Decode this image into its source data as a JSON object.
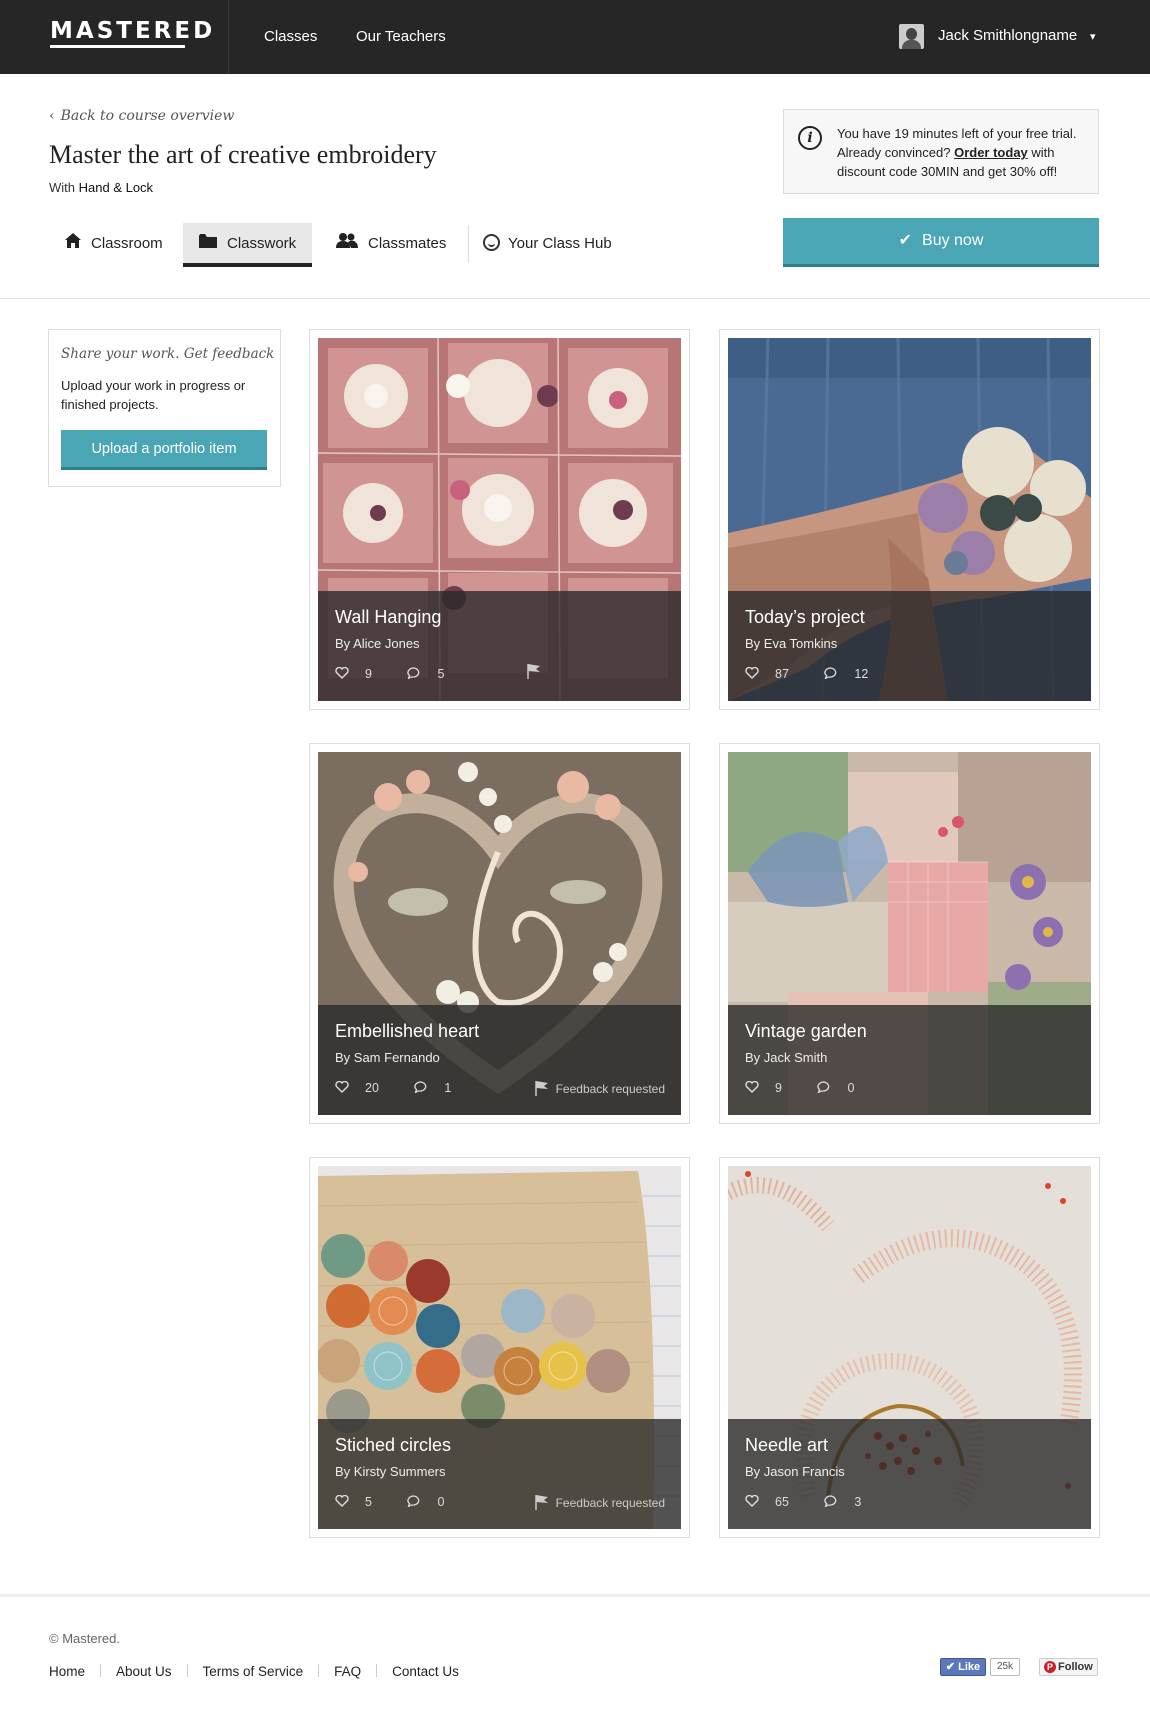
{
  "header": {
    "logo": "MASTERED",
    "nav": [
      "Classes",
      "Our Teachers"
    ],
    "user_name": "Jack Smithlongname",
    "user_caret": "▾"
  },
  "course": {
    "back_link": "Back to course overview",
    "title": "Master the art of creative embroidery",
    "by_prefix": "With",
    "by_name": "Hand & Lock"
  },
  "trial": {
    "line1": "You have 19 minutes left of your free trial.",
    "line2_prefix": "Already convinced?",
    "order_link": "Order today",
    "line2_suffix": "with discount code 30MIN and get 30% off!"
  },
  "buy_button": "Buy now",
  "tabs": [
    {
      "label": "Classroom",
      "icon": "home-icon"
    },
    {
      "label": "Classwork",
      "icon": "folder-icon",
      "active": true
    },
    {
      "label": "Classmates",
      "icon": "people-icon"
    },
    {
      "label": "Your Class Hub",
      "icon": "smile-icon"
    }
  ],
  "share": {
    "title": "Share your work. Get feedback",
    "text": "Upload your work in progress or finished projects.",
    "button": "Upload a portfolio item"
  },
  "portfolio": [
    {
      "title": "Wall Hanging",
      "by": "By Alice Jones",
      "likes": "9",
      "comments": "5",
      "flag": true,
      "feedback": ""
    },
    {
      "title": "Today’s project",
      "by": "By Eva Tomkins",
      "likes": "87",
      "comments": "12",
      "flag": false,
      "feedback": ""
    },
    {
      "title": "Embellished heart",
      "by": "By Sam Fernando",
      "likes": "20",
      "comments": "1",
      "flag": true,
      "feedback": "Feedback requested"
    },
    {
      "title": "Vintage garden",
      "by": "By Jack Smith",
      "likes": "9",
      "comments": "0",
      "flag": false,
      "feedback": ""
    },
    {
      "title": "Stiched circles",
      "by": "By Kirsty Summers",
      "likes": "5",
      "comments": "0",
      "flag": true,
      "feedback": "Feedback requested"
    },
    {
      "title": "Needle art",
      "by": "By Jason Francis",
      "likes": "65",
      "comments": "3",
      "flag": false,
      "feedback": ""
    }
  ],
  "footer": {
    "copyright": "© Mastered.",
    "links": [
      "Home",
      "About Us",
      "Terms of Service",
      "FAQ",
      "Contact Us"
    ],
    "fb_like": "Like",
    "fb_count": "25k",
    "pin_follow": "Follow"
  },
  "colors": {
    "accent": "#4aa6b5",
    "header_bg": "#262626"
  }
}
